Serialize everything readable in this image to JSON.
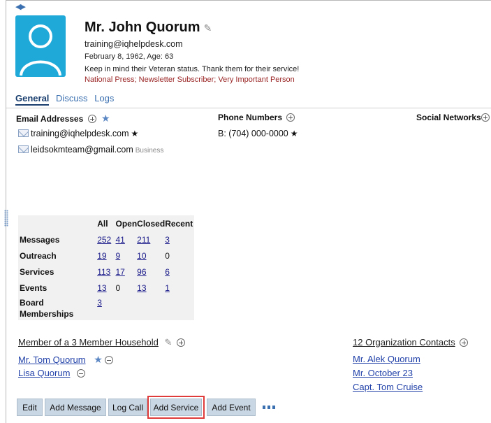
{
  "contact": {
    "name": "Mr. John Quorum",
    "email": "training@iqhelpdesk.com",
    "dob": "February 8, 1962, Age: 63",
    "note": "Keep in mind their Veteran status. Thank them for their service!",
    "tags": "National Press; Newsletter Subscriber; Very Important Person"
  },
  "tabs": [
    {
      "label": "General",
      "active": true
    },
    {
      "label": "Discuss",
      "active": false
    },
    {
      "label": "Logs",
      "active": false
    }
  ],
  "email_section": {
    "title": "Email Addresses",
    "items": [
      {
        "address": "training@iqhelpdesk.com",
        "primary": "★",
        "tag": ""
      },
      {
        "address": "leidsokmteam@gmail.com",
        "primary": "",
        "tag": "Business"
      }
    ]
  },
  "phone_section": {
    "title": "Phone Numbers",
    "items": [
      {
        "value": "B: (704) 000-0000",
        "primary": "★"
      }
    ]
  },
  "social_section": {
    "title": "Social Networks"
  },
  "stats": {
    "headers": [
      "All",
      "Open",
      "Closed",
      "Recent"
    ],
    "rows": [
      {
        "label": "Messages",
        "all": "252",
        "open": "41",
        "closed": "211",
        "recent": "3"
      },
      {
        "label": "Outreach",
        "all": "19",
        "open": "9",
        "closed": "10",
        "recent": "0"
      },
      {
        "label": "Services",
        "all": "113",
        "open": "17",
        "closed": "96",
        "recent": "6"
      },
      {
        "label": "Events",
        "all": "13",
        "open": "0",
        "closed": "13",
        "recent": "1"
      },
      {
        "label": "Board Memberships",
        "all": "3",
        "open": "",
        "closed": "",
        "recent": ""
      }
    ]
  },
  "household": {
    "title": "Member of a 3 Member Household",
    "members": [
      "Mr. Tom Quorum",
      "Lisa Quorum"
    ]
  },
  "organizations": {
    "title": "12 Organization Contacts",
    "items": [
      "Mr. Alek Quorum",
      "Mr. October 23",
      "Capt. Tom Cruise"
    ]
  },
  "toolbar": {
    "edit": "Edit",
    "add_message": "Add Message",
    "log_call": "Log Call",
    "add_service": "Add Service",
    "add_event": "Add Event"
  },
  "colors": {
    "avatar": "#1fa9d8",
    "tags": "#9a2424",
    "button": "#c9d6e3",
    "highlight": "#e03b3b"
  }
}
